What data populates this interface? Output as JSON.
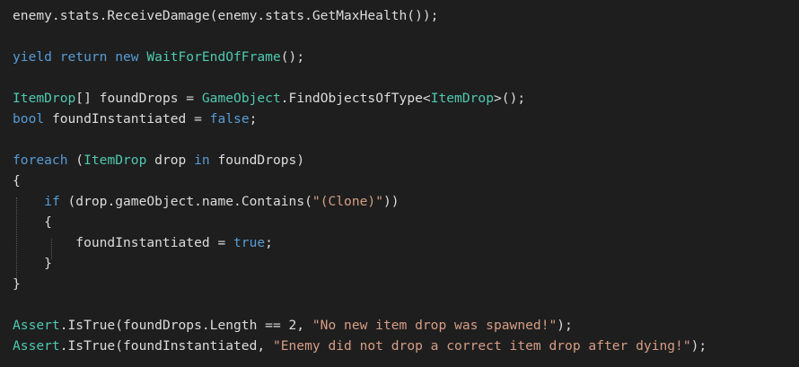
{
  "editor": {
    "colors": {
      "background": "#1e1e1e",
      "plain": "#dcdcdc",
      "keyword": "#569cd6",
      "type": "#4ec9b0",
      "string": "#d69d85",
      "indent_guide": "#5a5a5a"
    },
    "lines": [
      {
        "tokens": [
          {
            "t": "plain",
            "v": "enemy.stats.ReceiveDamage(enemy.stats.GetMaxHealth());"
          }
        ]
      },
      {
        "tokens": []
      },
      {
        "tokens": [
          {
            "t": "kw",
            "v": "yield return new "
          },
          {
            "t": "type",
            "v": "WaitForEndOfFrame"
          },
          {
            "t": "plain",
            "v": "();"
          }
        ]
      },
      {
        "tokens": []
      },
      {
        "tokens": [
          {
            "t": "type",
            "v": "ItemDrop"
          },
          {
            "t": "plain",
            "v": "[] foundDrops = "
          },
          {
            "t": "type",
            "v": "GameObject"
          },
          {
            "t": "plain",
            "v": ".FindObjectsOfType<"
          },
          {
            "t": "type",
            "v": "ItemDrop"
          },
          {
            "t": "plain",
            "v": ">();"
          }
        ]
      },
      {
        "tokens": [
          {
            "t": "kw",
            "v": "bool"
          },
          {
            "t": "plain",
            "v": " foundInstantiated = "
          },
          {
            "t": "kw",
            "v": "false"
          },
          {
            "t": "plain",
            "v": ";"
          }
        ]
      },
      {
        "tokens": []
      },
      {
        "tokens": [
          {
            "t": "kw",
            "v": "foreach"
          },
          {
            "t": "plain",
            "v": " ("
          },
          {
            "t": "type",
            "v": "ItemDrop"
          },
          {
            "t": "plain",
            "v": " drop "
          },
          {
            "t": "kw",
            "v": "in"
          },
          {
            "t": "plain",
            "v": " foundDrops)"
          }
        ]
      },
      {
        "tokens": [
          {
            "t": "plain",
            "v": "{"
          }
        ]
      },
      {
        "tokens": [
          {
            "t": "plain",
            "v": "    "
          },
          {
            "t": "kw",
            "v": "if"
          },
          {
            "t": "plain",
            "v": " (drop.gameObject.name.Contains("
          },
          {
            "t": "str",
            "v": "\"(Clone)\""
          },
          {
            "t": "plain",
            "v": "))"
          }
        ]
      },
      {
        "tokens": [
          {
            "t": "plain",
            "v": "    {"
          }
        ]
      },
      {
        "tokens": [
          {
            "t": "plain",
            "v": "        foundInstantiated = "
          },
          {
            "t": "kw",
            "v": "true"
          },
          {
            "t": "plain",
            "v": ";"
          }
        ]
      },
      {
        "tokens": [
          {
            "t": "plain",
            "v": "    }"
          }
        ]
      },
      {
        "tokens": [
          {
            "t": "plain",
            "v": "}"
          }
        ]
      },
      {
        "tokens": []
      },
      {
        "tokens": [
          {
            "t": "type",
            "v": "Assert"
          },
          {
            "t": "plain",
            "v": ".IsTrue(foundDrops.Length == 2, "
          },
          {
            "t": "str",
            "v": "\"No new item drop was spawned!\""
          },
          {
            "t": "plain",
            "v": ");"
          }
        ]
      },
      {
        "tokens": [
          {
            "t": "type",
            "v": "Assert"
          },
          {
            "t": "plain",
            "v": ".IsTrue(foundInstantiated, "
          },
          {
            "t": "str",
            "v": "\"Enemy did not drop a correct item drop after dying!\""
          },
          {
            "t": "plain",
            "v": ");"
          }
        ]
      }
    ]
  }
}
